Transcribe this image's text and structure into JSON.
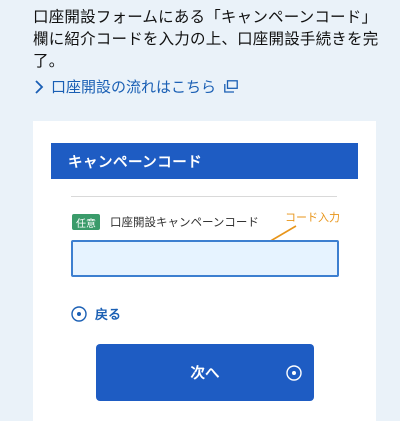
{
  "intro": {
    "text": "口座開設フォームにある「キャンペーンコード」欄に紹介コードを入力の上、口座開設手続きを完了。"
  },
  "flow_link": {
    "label": "口座開設の流れはこちら"
  },
  "panel": {
    "title": "キャンペーンコード",
    "badge": "任意",
    "field_label": "口座開設キャンペーンコード",
    "annotation": "コード入力",
    "input_value": "",
    "back_label": "戻る",
    "next_label": "次へ"
  },
  "colors": {
    "accent": "#1e5cc3",
    "badge": "#3a9b6a",
    "annotation": "#e8951a",
    "background": "#eaf2f9"
  },
  "icons": [
    "chevron-right-icon",
    "external-window-icon",
    "arrow-annotation-icon",
    "circle-left-icon",
    "circle-right-icon"
  ]
}
